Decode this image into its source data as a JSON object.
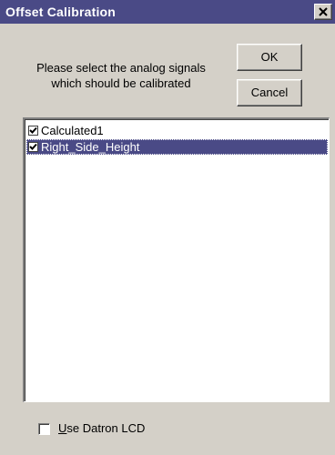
{
  "window": {
    "title": "Offset Calibration",
    "close_icon": "close-icon"
  },
  "prompt": {
    "line1": "Please select the analog signals",
    "line2": "which should be calibrated"
  },
  "buttons": {
    "ok_label": "OK",
    "cancel_label": "Cancel"
  },
  "signals": [
    {
      "label": "Calculated1",
      "checked": true,
      "selected": false
    },
    {
      "label": "Right_Side_Height",
      "checked": true,
      "selected": true
    }
  ],
  "options": {
    "use_datron_lcd_accel": "U",
    "use_datron_lcd_rest": "se Datron LCD",
    "use_datron_lcd_checked": false
  },
  "colors": {
    "titlebar": "#4a4a86",
    "selection": "#4a4a86",
    "face": "#d4d0c8"
  }
}
